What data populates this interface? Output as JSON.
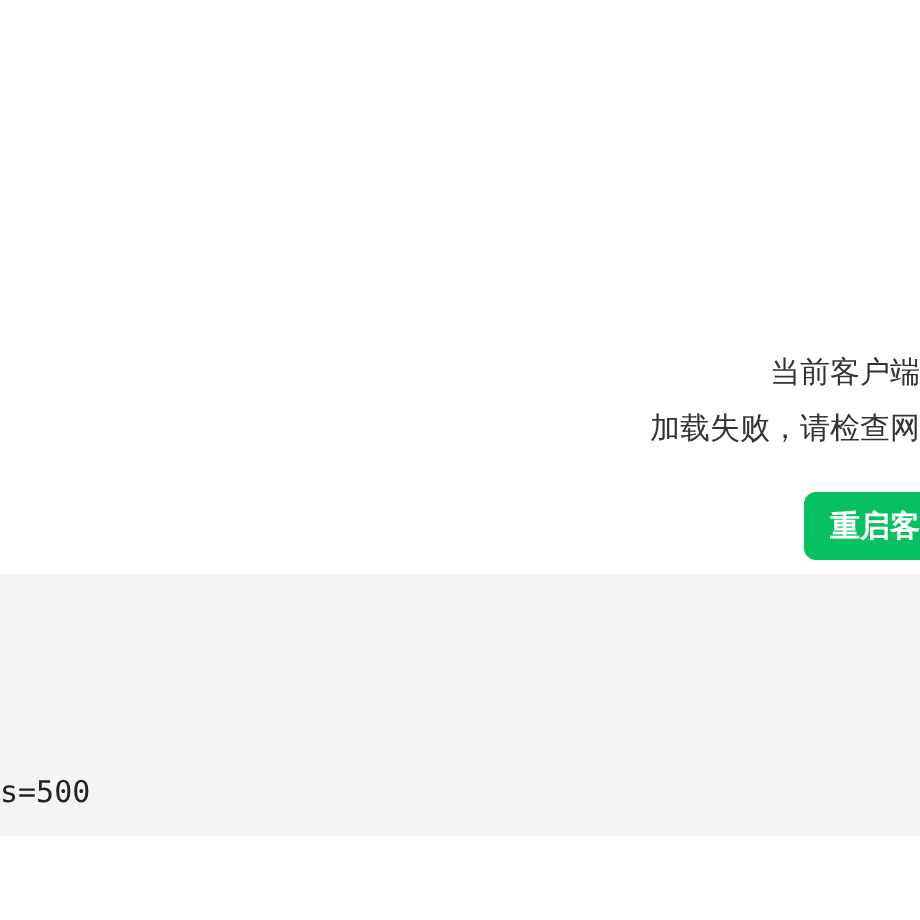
{
  "message": {
    "lines": [
      "当前客户端",
      "加载失败，请检查网"
    ]
  },
  "restart_button": {
    "label": "重启客"
  },
  "log_panel": {
    "text": "s=500"
  }
}
